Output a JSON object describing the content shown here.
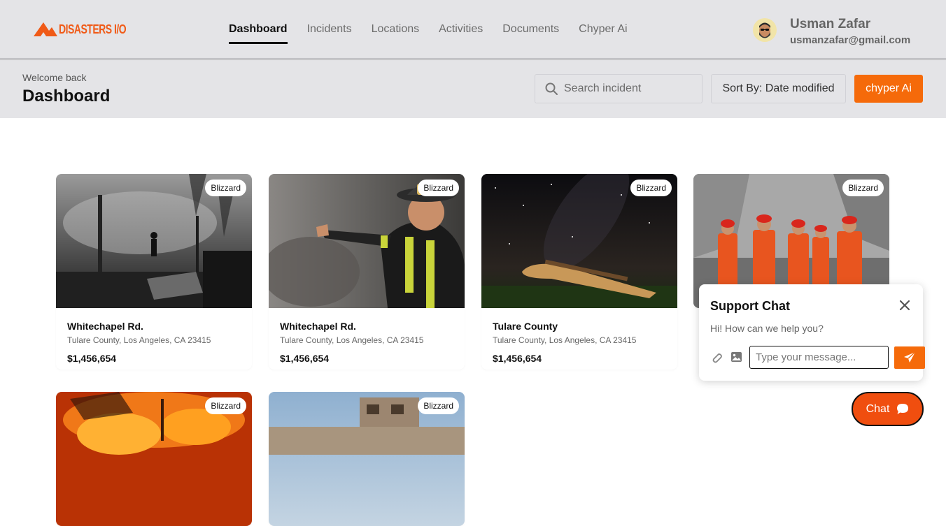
{
  "app": {
    "logo_text": "DISASTERS I/O",
    "accent_color": "#f56a0a"
  },
  "nav": {
    "items": [
      {
        "label": "Dashboard",
        "active": true
      },
      {
        "label": "Incidents",
        "active": false
      },
      {
        "label": "Locations",
        "active": false
      },
      {
        "label": "Activities",
        "active": false
      },
      {
        "label": "Documents",
        "active": false
      },
      {
        "label": "Chyper Ai",
        "active": false
      }
    ]
  },
  "user": {
    "name": "Usman Zafar",
    "email": "usmanzafar@gmail.com"
  },
  "header": {
    "welcome": "Welcome back",
    "title": "Dashboard",
    "search_placeholder": "Search incident",
    "sort_label": "Sort By: Date modified",
    "ai_button": "chyper Ai"
  },
  "cards": [
    {
      "badge": "Blizzard",
      "title": "Whitechapel Rd.",
      "address": "Tulare County, Los Angeles, CA 23415",
      "price": "$1,456,654",
      "image": "burned-houses-smoke"
    },
    {
      "badge": "Blizzard",
      "title": "Whitechapel Rd.",
      "address": "Tulare County, Los Angeles, CA 23415",
      "price": "$1,456,654",
      "image": "firefighter-pointing"
    },
    {
      "badge": "Blizzard",
      "title": "Tulare County",
      "address": "Tulare County, Los Angeles, CA 23415",
      "price": "$1,456,654",
      "image": "plane-wreck-night"
    },
    {
      "badge": "Blizzard",
      "title": "",
      "address": "",
      "price": "",
      "image": "rescue-team-rubble"
    },
    {
      "badge": "Blizzard",
      "title": "",
      "address": "",
      "price": "",
      "image": "house-fire"
    },
    {
      "badge": "Blizzard",
      "title": "",
      "address": "",
      "price": "",
      "image": "destroyed-building"
    }
  ],
  "support_chat": {
    "title": "Support Chat",
    "greeting": "Hi! How can we help you?",
    "input_placeholder": "Type your message...",
    "fab_label": "Chat"
  }
}
